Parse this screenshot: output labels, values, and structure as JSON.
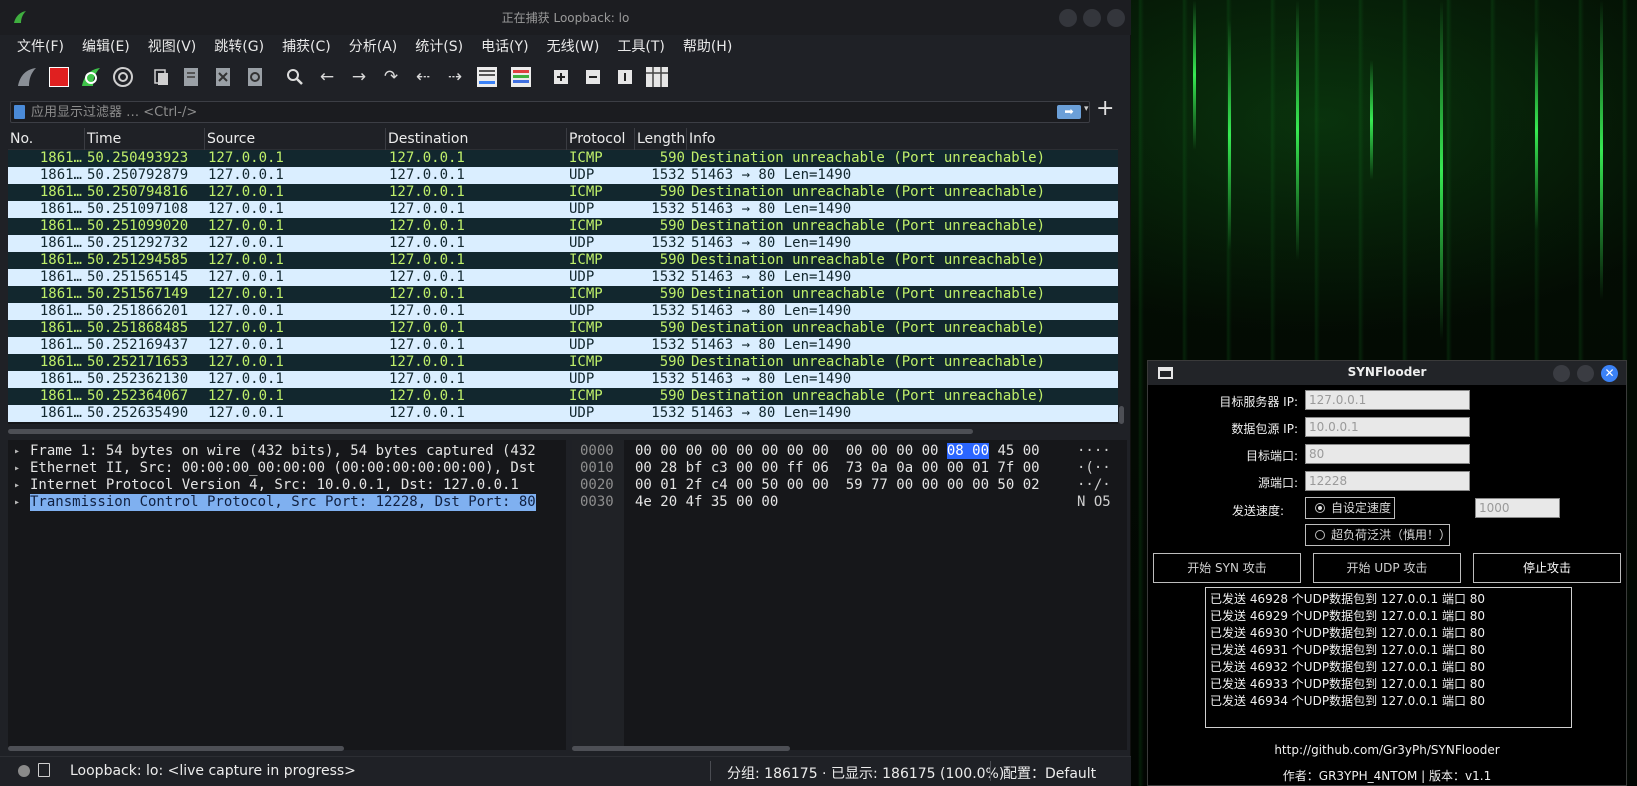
{
  "window": {
    "title": "正在捕获 Loopback: lo"
  },
  "menu": [
    "文件(F)",
    "编辑(E)",
    "视图(V)",
    "跳转(G)",
    "捕获(C)",
    "分析(A)",
    "统计(S)",
    "电话(Y)",
    "无线(W)",
    "工具(T)",
    "帮助(H)"
  ],
  "filter": {
    "placeholder": "应用显示过滤器 … <Ctrl-/>",
    "apply_glyph": "➡",
    "dropdown_glyph": "▾",
    "add_glyph": "+"
  },
  "packet_list": {
    "columns": [
      "No.",
      "Time",
      "Source",
      "Destination",
      "Protocol",
      "Length",
      "Info"
    ],
    "rows": [
      {
        "no": "1861…",
        "time": "50.250493923",
        "src": "127.0.0.1",
        "dst": "127.0.0.1",
        "proto": "ICMP",
        "len": "590",
        "info": "Destination unreachable (Port unreachable)"
      },
      {
        "no": "1861…",
        "time": "50.250792879",
        "src": "127.0.0.1",
        "dst": "127.0.0.1",
        "proto": "UDP",
        "len": "1532",
        "info": "51463 → 80 Len=1490"
      },
      {
        "no": "1861…",
        "time": "50.250794816",
        "src": "127.0.0.1",
        "dst": "127.0.0.1",
        "proto": "ICMP",
        "len": "590",
        "info": "Destination unreachable (Port unreachable)"
      },
      {
        "no": "1861…",
        "time": "50.251097108",
        "src": "127.0.0.1",
        "dst": "127.0.0.1",
        "proto": "UDP",
        "len": "1532",
        "info": "51463 → 80 Len=1490"
      },
      {
        "no": "1861…",
        "time": "50.251099020",
        "src": "127.0.0.1",
        "dst": "127.0.0.1",
        "proto": "ICMP",
        "len": "590",
        "info": "Destination unreachable (Port unreachable)"
      },
      {
        "no": "1861…",
        "time": "50.251292732",
        "src": "127.0.0.1",
        "dst": "127.0.0.1",
        "proto": "UDP",
        "len": "1532",
        "info": "51463 → 80 Len=1490"
      },
      {
        "no": "1861…",
        "time": "50.251294585",
        "src": "127.0.0.1",
        "dst": "127.0.0.1",
        "proto": "ICMP",
        "len": "590",
        "info": "Destination unreachable (Port unreachable)"
      },
      {
        "no": "1861…",
        "time": "50.251565145",
        "src": "127.0.0.1",
        "dst": "127.0.0.1",
        "proto": "UDP",
        "len": "1532",
        "info": "51463 → 80 Len=1490"
      },
      {
        "no": "1861…",
        "time": "50.251567149",
        "src": "127.0.0.1",
        "dst": "127.0.0.1",
        "proto": "ICMP",
        "len": "590",
        "info": "Destination unreachable (Port unreachable)"
      },
      {
        "no": "1861…",
        "time": "50.251866201",
        "src": "127.0.0.1",
        "dst": "127.0.0.1",
        "proto": "UDP",
        "len": "1532",
        "info": "51463 → 80 Len=1490"
      },
      {
        "no": "1861…",
        "time": "50.251868485",
        "src": "127.0.0.1",
        "dst": "127.0.0.1",
        "proto": "ICMP",
        "len": "590",
        "info": "Destination unreachable (Port unreachable)"
      },
      {
        "no": "1861…",
        "time": "50.252169437",
        "src": "127.0.0.1",
        "dst": "127.0.0.1",
        "proto": "UDP",
        "len": "1532",
        "info": "51463 → 80 Len=1490"
      },
      {
        "no": "1861…",
        "time": "50.252171653",
        "src": "127.0.0.1",
        "dst": "127.0.0.1",
        "proto": "ICMP",
        "len": "590",
        "info": "Destination unreachable (Port unreachable)"
      },
      {
        "no": "1861…",
        "time": "50.252362130",
        "src": "127.0.0.1",
        "dst": "127.0.0.1",
        "proto": "UDP",
        "len": "1532",
        "info": "51463 → 80 Len=1490"
      },
      {
        "no": "1861…",
        "time": "50.252364067",
        "src": "127.0.0.1",
        "dst": "127.0.0.1",
        "proto": "ICMP",
        "len": "590",
        "info": "Destination unreachable (Port unreachable)"
      },
      {
        "no": "1861…",
        "time": "50.252635490",
        "src": "127.0.0.1",
        "dst": "127.0.0.1",
        "proto": "UDP",
        "len": "1532",
        "info": "51463 → 80 Len=1490"
      }
    ]
  },
  "details": [
    {
      "text": "Frame 1: 54 bytes on wire (432 bits), 54 bytes captured (432",
      "selected": false
    },
    {
      "text": "Ethernet II, Src: 00:00:00_00:00:00 (00:00:00:00:00:00), Dst",
      "selected": false
    },
    {
      "text": "Internet Protocol Version 4, Src: 10.0.0.1, Dst: 127.0.0.1",
      "selected": false
    },
    {
      "text": "Transmission Control Protocol, Src Port: 12228, Dst Port: 80",
      "selected": true
    }
  ],
  "hex": {
    "rows": [
      {
        "offset": "0000",
        "pre": "00 00 00 00 00 00 00 00  00 00 00 00 ",
        "sel": "08 00",
        "post": " 45 00",
        "ascii": "····"
      },
      {
        "offset": "0010",
        "pre": "00 28 bf c3 00 00 ff 06  73 0a 0a 00 00 01 7f 00",
        "sel": "",
        "post": "",
        "ascii": "·(··"
      },
      {
        "offset": "0020",
        "pre": "00 01 2f c4 00 50 00 00  59 77 00 00 00 00 50 02",
        "sel": "",
        "post": "",
        "ascii": "··/·"
      },
      {
        "offset": "0030",
        "pre": "4e 20 4f 35 00 00",
        "sel": "",
        "post": "",
        "ascii": "N O5"
      }
    ]
  },
  "status": {
    "capture": "Loopback: lo: <live capture in progress>",
    "packets": "分组: 186175 · 已显示: 186175 (100.0%)",
    "profile": "配置：Default"
  },
  "synflooder": {
    "title": "SYNFlooder",
    "target_ip_label": "目标服务器 IP:",
    "target_ip": "127.0.0.1",
    "source_ip_label": "数据包源 IP:",
    "source_ip": "10.0.0.1",
    "target_port_label": "目标端口:",
    "target_port": "80",
    "source_port_label": "源端口:",
    "source_port": "12228",
    "speed_label": "发送速度:",
    "custom_speed_label": "自设定速度",
    "custom_speed_value": "1000",
    "overload_label": "超负荷泛洪（慎用！）",
    "start_syn": "开始 SYN 攻击",
    "start_udp": "开始 UDP 攻击",
    "stop": "停止攻击",
    "log": [
      "已发送 46928 个UDP数据包到 127.0.0.1 端口 80",
      "已发送 46929 个UDP数据包到 127.0.0.1 端口 80",
      "已发送 46930 个UDP数据包到 127.0.0.1 端口 80",
      "已发送 46931 个UDP数据包到 127.0.0.1 端口 80",
      "已发送 46932 个UDP数据包到 127.0.0.1 端口 80",
      "已发送 46933 个UDP数据包到 127.0.0.1 端口 80",
      "已发送 46934 个UDP数据包到 127.0.0.1 端口 80"
    ],
    "url": "http://github.com/Gr3yPh/SYNFlooder",
    "author": "作者：GR3YPH_4NTOM | 版本：v1.1"
  },
  "colors": {
    "icmp_bg": "#12272e",
    "icmp_fg": "#bfef6a",
    "udp_bg": "#daeeff",
    "udp_fg": "#12272e",
    "selection": "#7fb0f0",
    "hex_selection": "#2b66ff"
  },
  "icons": {
    "app": "wireshark-fin-icon",
    "toolbar": [
      "start-capture-fin-icon",
      "stop-capture-icon",
      "restart-capture-icon",
      "capture-options-gear-icon",
      "open-file-icon",
      "save-file-icon",
      "close-file-icon",
      "reload-file-icon",
      "find-packet-icon",
      "go-back-icon",
      "go-forward-icon",
      "go-to-packet-icon",
      "go-first-icon",
      "go-last-icon",
      "autoscroll-icon",
      "colorize-icon",
      "zoom-in-icon",
      "zoom-out-icon",
      "normal-size-icon",
      "resize-columns-icon"
    ]
  }
}
